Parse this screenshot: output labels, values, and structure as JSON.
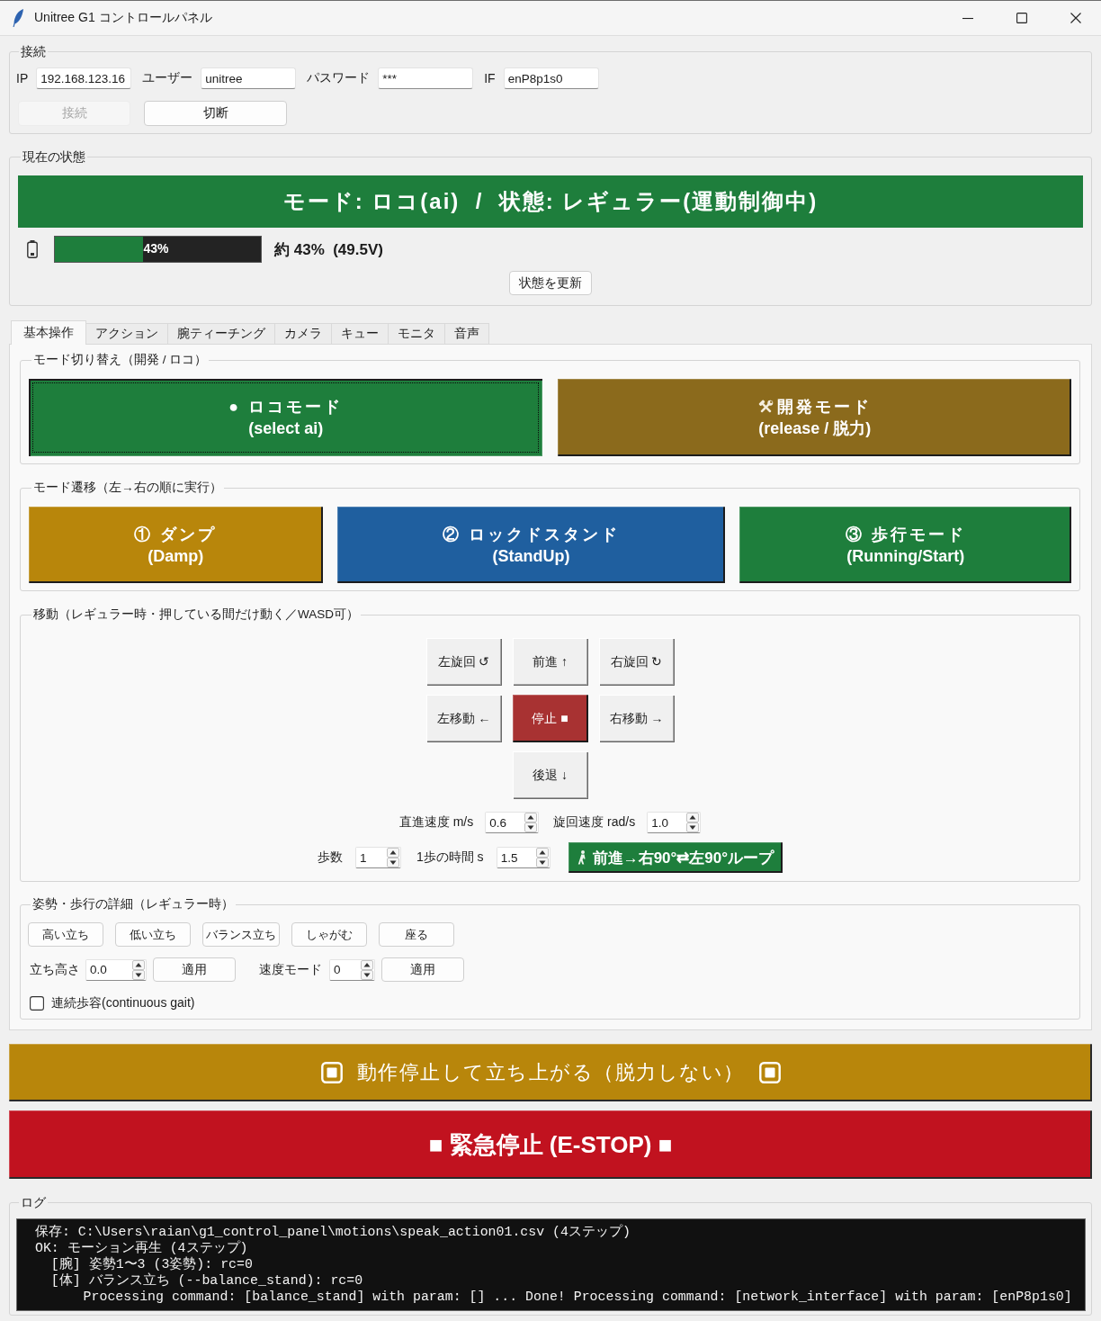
{
  "window": {
    "title": "Unitree G1 コントロールパネル"
  },
  "connection": {
    "title": "接続",
    "fields": [
      {
        "label": "IP",
        "value": "192.168.123.16"
      },
      {
        "label": "ユーザー",
        "value": "unitree"
      },
      {
        "label": "パスワード",
        "value": "***"
      },
      {
        "label": "IF",
        "value": "enP8p1s0"
      }
    ],
    "buttons": [
      {
        "label": "接続",
        "disabled": true
      },
      {
        "label": "切断",
        "disabled": false
      }
    ]
  },
  "status": {
    "title": "現在の状態",
    "banner": "モード: ロコ(ai)  /  状態: レギュラー(運動制御中)",
    "battery": {
      "level": 0.43,
      "bar_label": "43%",
      "reading": "約 43%  (49.5V)"
    },
    "refresh_button": "状態を更新"
  },
  "tabs": [
    {
      "label": "基本操作",
      "selected": true
    },
    {
      "label": "アクション",
      "selected": false
    },
    {
      "label": "腕ティーチング",
      "selected": false
    },
    {
      "label": "カメラ",
      "selected": false
    },
    {
      "label": "キュー",
      "selected": false
    },
    {
      "label": "モニタ",
      "selected": false
    },
    {
      "label": "音声",
      "selected": false
    }
  ],
  "mode_switch": {
    "title": "モード切り替え（開発 / ロコ）",
    "buttons": [
      {
        "kind": "plain",
        "title": "● ロコモード",
        "subtitle": "(select ai)",
        "color": "#1e7e3c",
        "selected": true
      },
      {
        "kind": "tools",
        "title": "開発モード",
        "subtitle": "(release / 脱力)",
        "color": "#8b6a1c",
        "selected": false
      }
    ]
  },
  "mode_transition": {
    "title": "モード遷移（左→右の順に実行）",
    "buttons": [
      {
        "title": "① ダンプ",
        "subtitle": "(Damp)",
        "color": "#b8860b"
      },
      {
        "title": "② ロックドスタンド",
        "subtitle": "(StandUp)",
        "color": "#1f5f9f"
      },
      {
        "title": "③ 歩行モード",
        "subtitle": "(Running/Start)",
        "color": "#1e7e3c"
      }
    ]
  },
  "move": {
    "title": "移動（レギュラー時・押している間だけ動く／WASD可）",
    "rows": [
      {
        "buttons": [
          {
            "label": "左旋回 ↺",
            "kind": "normal"
          },
          {
            "label": "前進 ↑",
            "kind": "normal"
          },
          {
            "label": "右旋回 ↻",
            "kind": "normal"
          }
        ]
      },
      {
        "buttons": [
          {
            "label": "左移動 ←",
            "kind": "normal"
          },
          {
            "label": "停止 ■",
            "kind": "stop"
          },
          {
            "label": "右移動 →",
            "kind": "normal"
          }
        ]
      },
      {
        "buttons": [
          {
            "label": "後退 ↓",
            "kind": "normal"
          }
        ]
      }
    ],
    "speeds": [
      {
        "label": "直進速度 m/s",
        "value": "0.6"
      },
      {
        "label": "旋回速度 rad/s",
        "value": "1.0"
      }
    ],
    "steps": [
      {
        "label": "歩数",
        "value": "1"
      },
      {
        "label": "1歩の時間 s",
        "value": "1.5"
      }
    ],
    "loop_button": "前進→右90°⇄左90°ループ"
  },
  "posture": {
    "title": "姿勢・歩行の詳細（レギュラー時）",
    "presets": [
      "高い立ち",
      "低い立ち",
      "バランス立ち",
      "しゃがむ",
      "座る"
    ],
    "params": [
      {
        "label": "立ち高さ",
        "value": "0.0",
        "button": "適用"
      },
      {
        "label": "速度モード",
        "value": "0",
        "button": "適用"
      }
    ],
    "continuous_gait": {
      "label": "連続歩容(continuous gait)",
      "checked": false
    }
  },
  "stand_button": "動作停止して立ち上がる（脱力しない）",
  "estop_button": "■ 緊急停止 (E-STOP) ■",
  "log": {
    "title": "ログ",
    "lines": [
      "保存: C:\\Users\\raian\\g1_control_panel\\motions\\speak_action01.csv (4ステップ)",
      "OK: モーション再生 (4ステップ)",
      "  [腕] 姿勢1〜3 (3姿勢): rc=0",
      "  [体] バランス立ち (--balance_stand): rc=0",
      "      Processing command: [balance_stand] with param: [] ... Done! Processing command: [network_interface] with param: [enP8p1s0]"
    ]
  }
}
